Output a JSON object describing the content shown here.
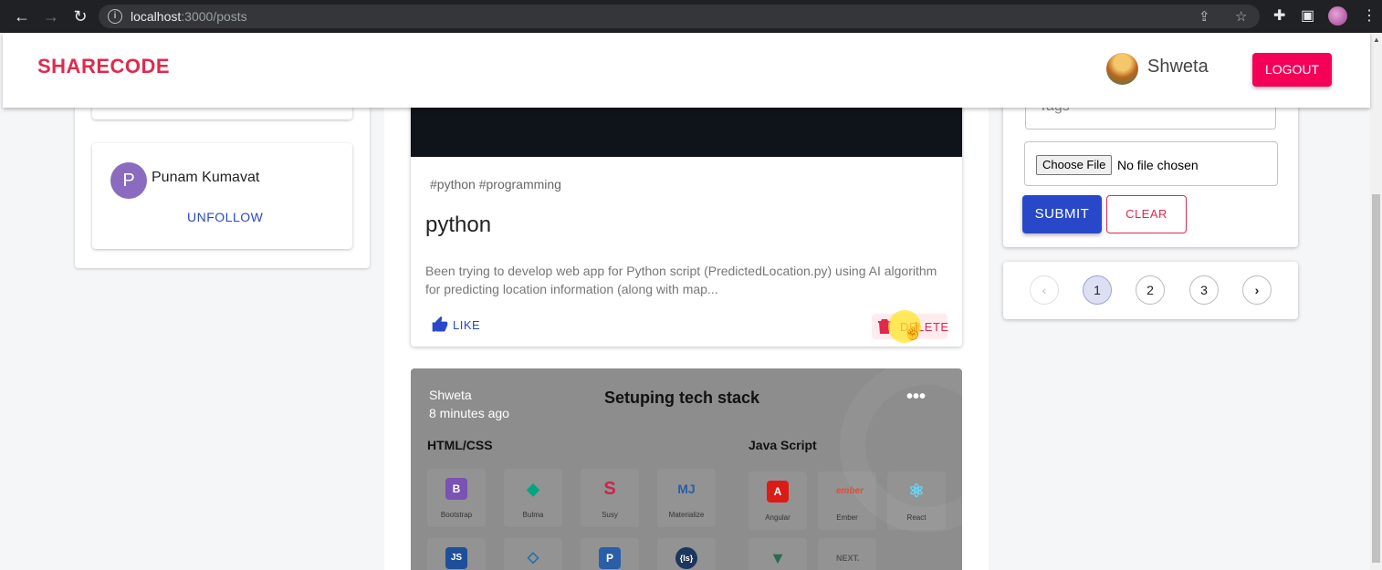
{
  "browser": {
    "url_host": "localhost",
    "url_path": ":3000/posts"
  },
  "header": {
    "logo": "SHARECODE",
    "user_name": "Shweta",
    "logout_label": "LOGOUT"
  },
  "sidebar": {
    "following": [
      {
        "initial": "P",
        "name": "Punam Kumavat",
        "action": "UNFOLLOW"
      }
    ]
  },
  "posts": [
    {
      "tags": "#python #programming",
      "title": "python",
      "body": "Been trying to develop web app for Python script (PredictedLocation.py) using AI algorithm for predicting location information (along with map...",
      "like_label": "LIKE",
      "delete_label": "DELETE"
    },
    {
      "author": "Shweta",
      "time": "8 minutes ago",
      "title": "Setuping tech stack",
      "sections": [
        {
          "heading": "HTML/CSS",
          "items": [
            "Bootstrap",
            "Bulma",
            "Susy",
            "Materialize"
          ]
        },
        {
          "heading": "Java Script",
          "items": [
            "Angular",
            "Ember",
            "React"
          ]
        }
      ]
    }
  ],
  "form": {
    "tags_placeholder": "Tags",
    "file_button": "Choose File",
    "file_status": "No file chosen",
    "submit_label": "SUBMIT",
    "clear_label": "CLEAR"
  },
  "pagination": {
    "pages": [
      "1",
      "2",
      "3"
    ],
    "current": "1"
  }
}
